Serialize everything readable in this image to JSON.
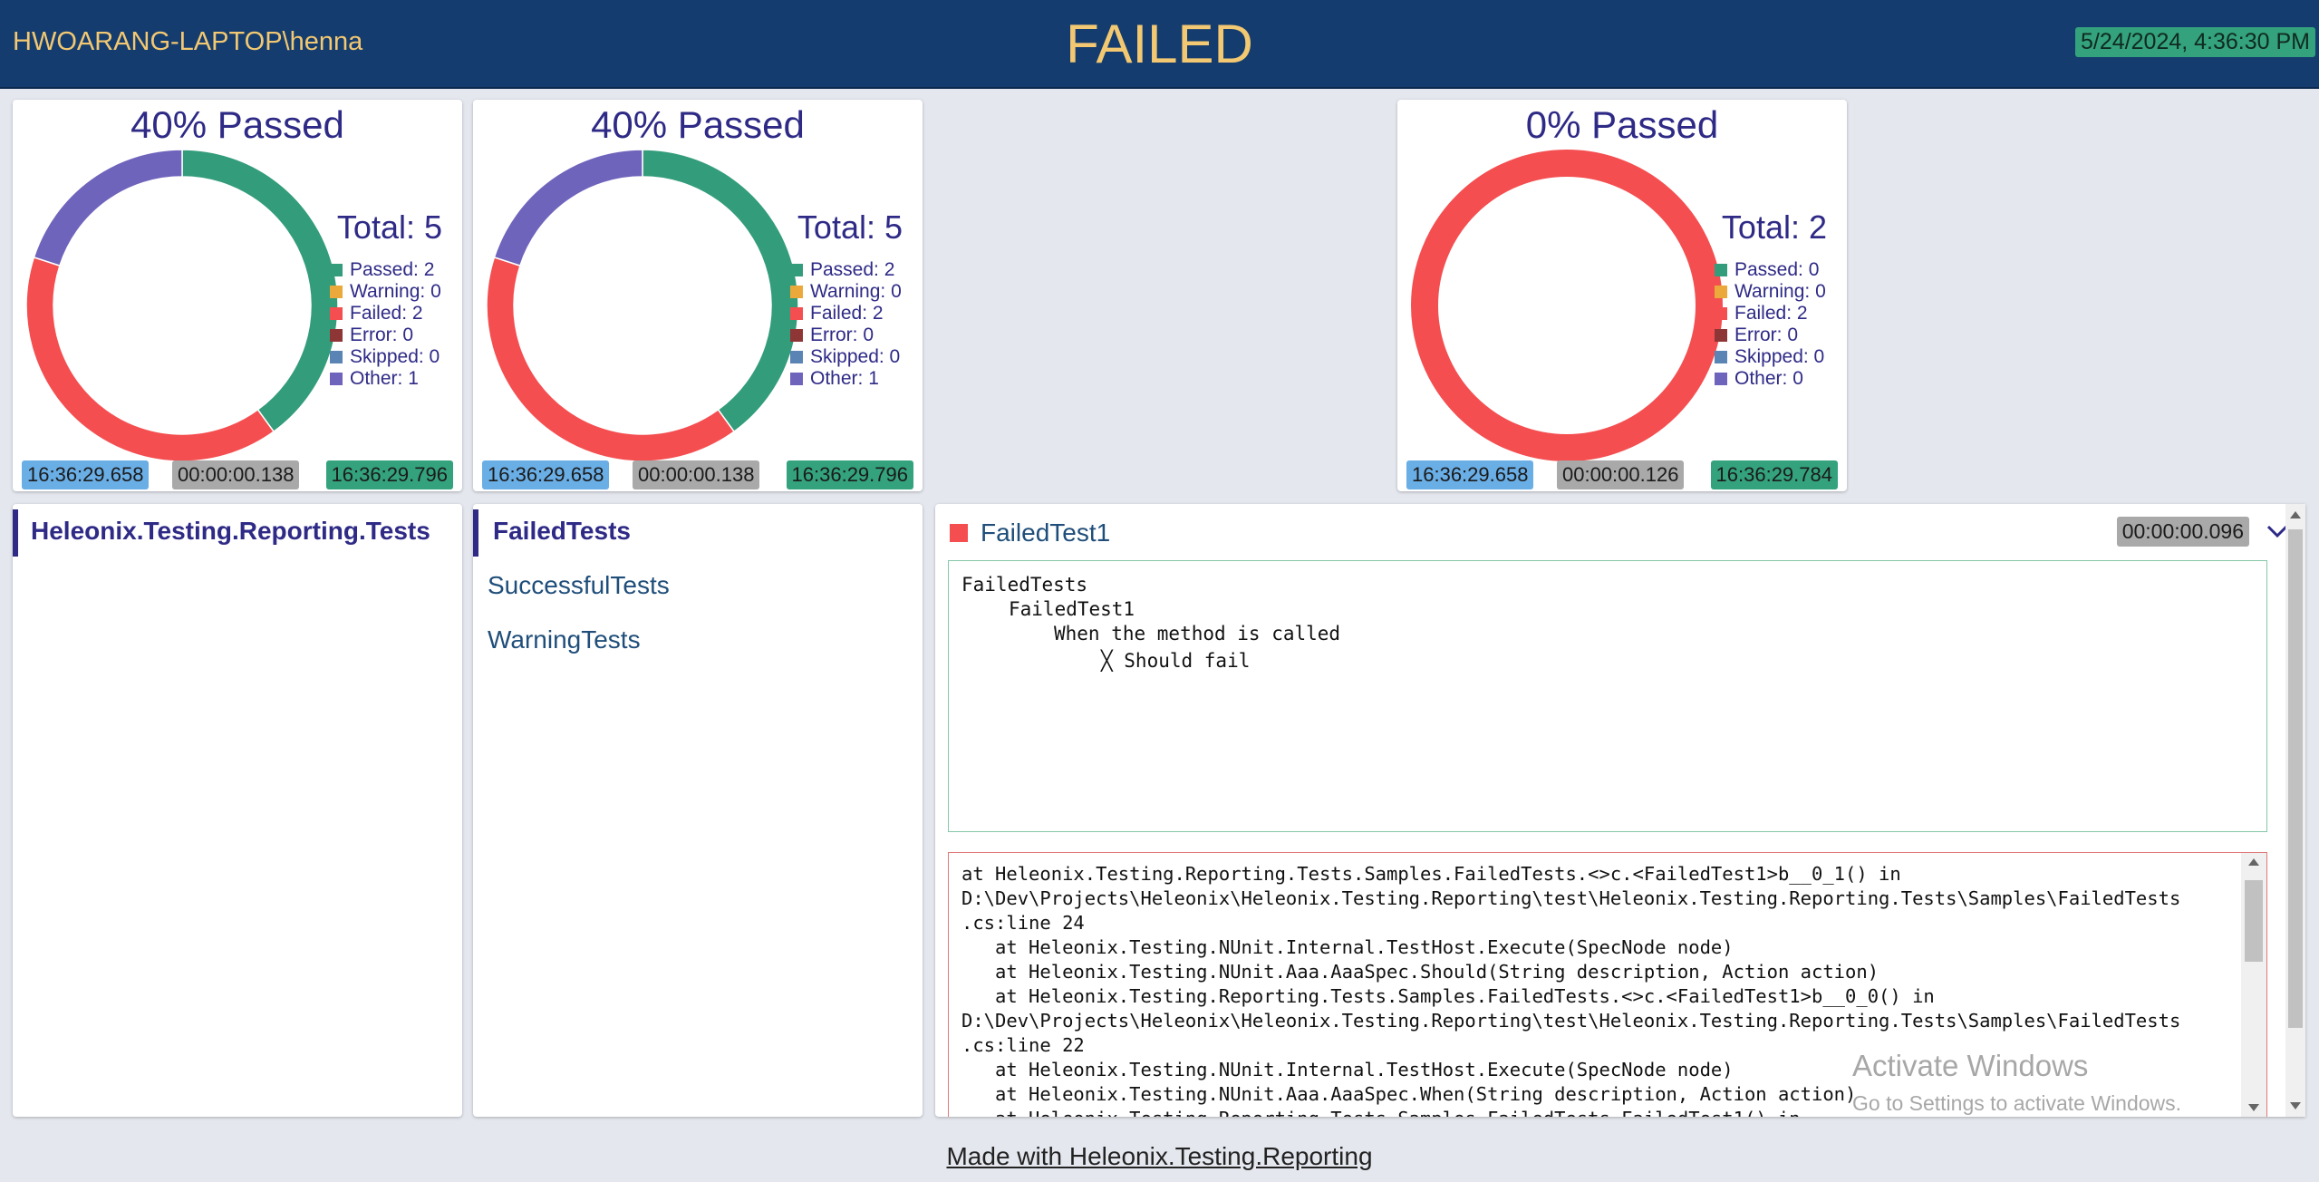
{
  "header": {
    "machine": "HWOARANG-LAPTOP\\henna",
    "status": "FAILED",
    "datetime": "5/24/2024, 4:36:30 PM"
  },
  "colors": {
    "header_bg": "#143c6e",
    "header_text": "#f3c872",
    "accent": "#2e2a86",
    "passed": "#339c7b",
    "warning": "#eaa93a",
    "failed": "#f44e50",
    "error": "#8e3535",
    "skipped": "#5a84b3",
    "other": "#6f64bc"
  },
  "legend_labels": {
    "passed": "Passed",
    "warning": "Warning",
    "failed": "Failed",
    "error": "Error",
    "skipped": "Skipped",
    "other": "Other"
  },
  "summaries": [
    {
      "percent_text": "40% Passed",
      "total_text": "Total: 5",
      "counts": {
        "passed": 2,
        "warning": 0,
        "failed": 2,
        "error": 0,
        "skipped": 0,
        "other": 1
      },
      "start": "16:36:29.658",
      "duration": "00:00:00.138",
      "end": "16:36:29.796"
    },
    {
      "percent_text": "40% Passed",
      "total_text": "Total: 5",
      "counts": {
        "passed": 2,
        "warning": 0,
        "failed": 2,
        "error": 0,
        "skipped": 0,
        "other": 1
      },
      "start": "16:36:29.658",
      "duration": "00:00:00.138",
      "end": "16:36:29.796"
    },
    {
      "percent_text": "0% Passed",
      "total_text": "Total: 2",
      "counts": {
        "passed": 0,
        "warning": 0,
        "failed": 2,
        "error": 0,
        "skipped": 0,
        "other": 0
      },
      "start": "16:36:29.658",
      "duration": "00:00:00.126",
      "end": "16:36:29.784"
    }
  ],
  "assemblies": [
    "Heleonix.Testing.Reporting.Tests"
  ],
  "fixtures": [
    "FailedTests",
    "SuccessfulTests",
    "WarningTests"
  ],
  "test": {
    "name": "FailedTest1",
    "duration": "00:00:00.096",
    "output": {
      "line1": "FailedTests",
      "line2": "FailedTest1",
      "line3": "When the method is called",
      "line4": "╳ Should fail"
    },
    "stack_trace": "at Heleonix.Testing.Reporting.Tests.Samples.FailedTests.<>c.<FailedTest1>b__0_1() in\nD:\\Dev\\Projects\\Heleonix\\Heleonix.Testing.Reporting\\test\\Heleonix.Testing.Reporting.Tests\\Samples\\FailedTests\n.cs:line 24\n   at Heleonix.Testing.NUnit.Internal.TestHost.Execute(SpecNode node)\n   at Heleonix.Testing.NUnit.Aaa.AaaSpec.Should(String description, Action action)\n   at Heleonix.Testing.Reporting.Tests.Samples.FailedTests.<>c.<FailedTest1>b__0_0() in\nD:\\Dev\\Projects\\Heleonix\\Heleonix.Testing.Reporting\\test\\Heleonix.Testing.Reporting.Tests\\Samples\\FailedTests\n.cs:line 22\n   at Heleonix.Testing.NUnit.Internal.TestHost.Execute(SpecNode node)\n   at Heleonix.Testing.NUnit.Aaa.AaaSpec.When(String description, Action action)\n   at Heleonix.Testing.Reporting.Tests.Samples.FailedTests.FailedTest1() in"
  },
  "watermark": {
    "title": "Activate Windows",
    "subtitle": "Go to Settings to activate Windows."
  },
  "footer": "Made with Heleonix.Testing.Reporting"
}
